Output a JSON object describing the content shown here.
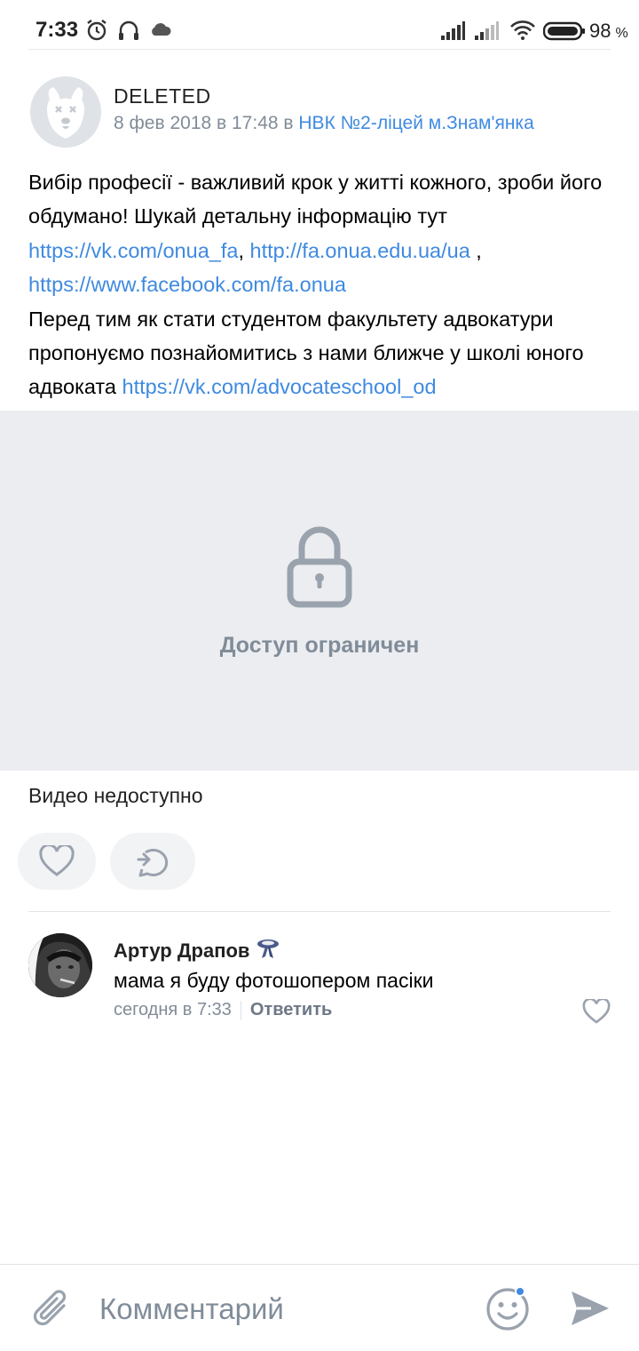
{
  "status_bar": {
    "time": "7:33",
    "battery": "98",
    "battery_unit": "%",
    "icons": [
      "alarm-icon",
      "headphones-icon",
      "cloud-icon",
      "signal-icon",
      "signal-icon",
      "wifi-icon",
      "battery-icon"
    ]
  },
  "post": {
    "author": "DELETED",
    "date": "8 фев 2018 в 17:48 в ",
    "group": "НВК №2-ліцей м.Знам'янка",
    "text": {
      "p1": "Вибір професії - важливий крок у житті кожного, зроби його обдумано! Шукай детальну інформацію тут ",
      "link1": "https://vk.com/onua_fa",
      "sep1": ", ",
      "link2": "http://fa.onua.edu.ua/ua",
      "sep2": " , ",
      "link3": "https://www.facebook.com/fa.onua",
      "p2": "Перед тим як стати студентом факультету адвокатури пропонуємо познайомитись з нами ближче у школі юного адвоката ",
      "link4": "https://vk.com/advocateschool_od"
    },
    "media_restricted_label": "Доступ ограничен",
    "video_unavailable": "Видео недоступно"
  },
  "comment": {
    "author": "Артур Драпов",
    "text": "мама я буду фотошопером пасіки",
    "time": "сегодня в 7:33",
    "reply_label": "Ответить"
  },
  "composer": {
    "placeholder": "Комментарий"
  },
  "colors": {
    "link": "#3f8ae0",
    "secondary_text": "#818c99",
    "media_bg": "#ebedf0",
    "button_bg": "#f2f3f5"
  }
}
